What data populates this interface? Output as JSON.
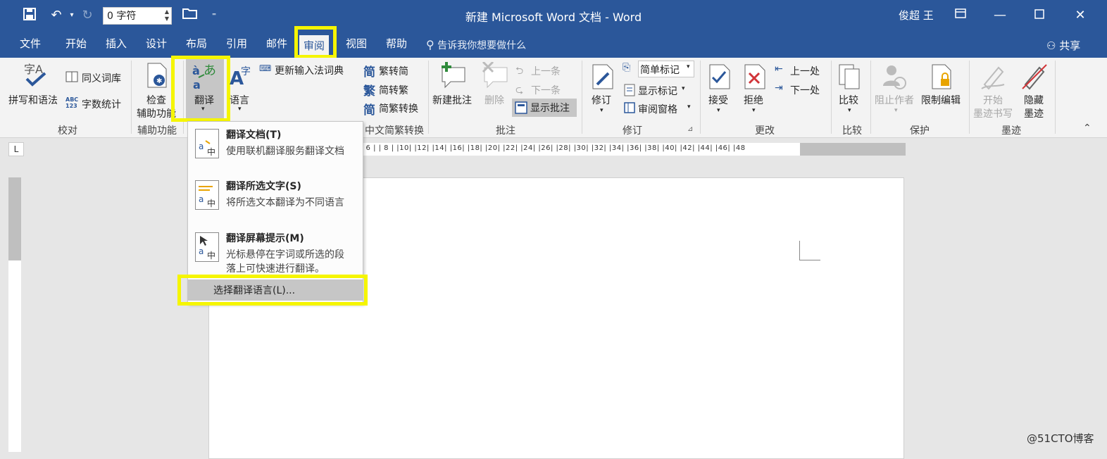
{
  "titlebar": {
    "title": "新建 Microsoft Word 文档  -  Word",
    "counter_value": "0 字符",
    "user": "俊超 王"
  },
  "tabs": [
    {
      "label": "文件"
    },
    {
      "label": "开始"
    },
    {
      "label": "插入"
    },
    {
      "label": "设计"
    },
    {
      "label": "布局"
    },
    {
      "label": "引用"
    },
    {
      "label": "邮件"
    },
    {
      "label": "审阅"
    },
    {
      "label": "视图"
    },
    {
      "label": "帮助"
    }
  ],
  "search_placeholder": "告诉我你想要做什么",
  "share_label": "共享",
  "ribbon": {
    "proofing": {
      "spell": "拼写和语法",
      "thesaurus": "同义词库",
      "wordcount": "字数统计",
      "group": "校对"
    },
    "accessibility": {
      "check_line1": "检查",
      "check_line2": "辅助功能",
      "group": "辅助功能"
    },
    "language": {
      "translate": "翻译",
      "language": "语言",
      "update_ime": "更新输入法词典"
    },
    "chinese": {
      "trad_to_simp": "繁转简",
      "simp_to_trad": "简转繁",
      "convert": "简繁转换",
      "group": "中文简繁转换"
    },
    "comments": {
      "new": "新建批注",
      "delete": "删除",
      "prev": "上一条",
      "next": "下一条",
      "show": "显示批注",
      "group": "批注"
    },
    "tracking": {
      "track": "修订",
      "simple_markup": "简单标记",
      "show_markup": "显示标记",
      "reviewing_pane": "审阅窗格",
      "group": "修订"
    },
    "changes": {
      "accept": "接受",
      "reject": "拒绝",
      "prev": "上一处",
      "next": "下一处",
      "group": "更改"
    },
    "compare": {
      "compare": "比较",
      "group": "比较"
    },
    "protect": {
      "block_authors": "阻止作者",
      "restrict": "限制编辑",
      "group": "保护"
    },
    "ink": {
      "start_line1": "开始",
      "start_line2": "墨迹书写",
      "hide_line1": "隐藏",
      "hide_line2": "墨迹",
      "group": "墨迹"
    }
  },
  "translate_menu": {
    "items": [
      {
        "title": "翻译文档(T)",
        "desc": "使用联机翻译服务翻译文档"
      },
      {
        "title": "翻译所选文字(S)",
        "desc": "将所选文本翻译为不同语言"
      },
      {
        "title": "翻译屏幕提示(M)",
        "desc": "光标悬停在字词或所选的段落上可快速进行翻译。"
      }
    ],
    "choose_language": "选择翻译语言(L)..."
  },
  "ruler": {
    "tab_selector": "L",
    "h_marks": "| 6 |  | 8 |  |10|  |12|  |14|  |16|  |18|  |20|  |22|  |24|  |26|  |28|  |30|  |32|  |34|  |36|  |38|  |40|  |42|  |44|  |46|  |48"
  },
  "watermark": "@51CTO博客",
  "colors": {
    "accent": "#2b579a",
    "highlight": "#f5f500"
  }
}
